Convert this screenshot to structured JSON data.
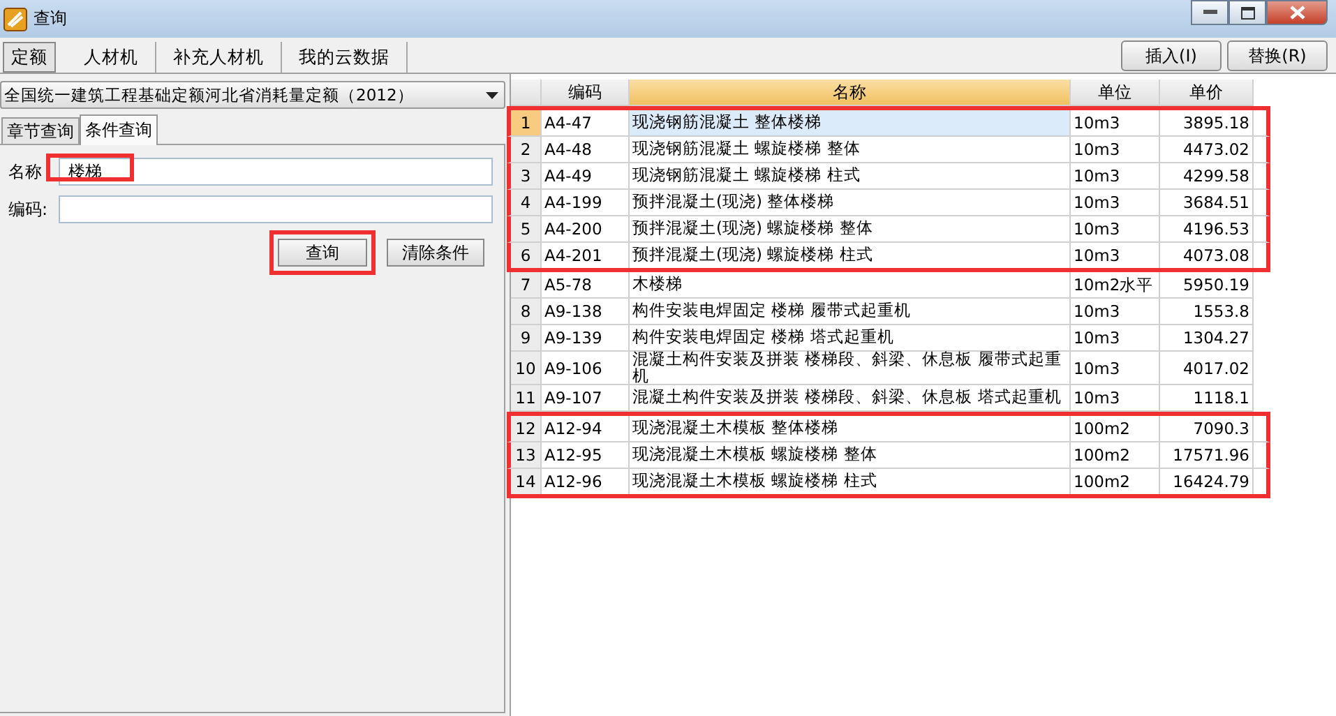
{
  "window": {
    "title": "查询"
  },
  "tabs": [
    {
      "label": "定额",
      "selected": true
    },
    {
      "label": "人材机",
      "selected": false
    },
    {
      "label": "补充人材机",
      "selected": false
    },
    {
      "label": "我的云数据",
      "selected": false
    }
  ],
  "actions": [
    "插入(I)",
    "替换(R)"
  ],
  "library": {
    "value": "全国统一建筑工程基础定额河北省消耗量定额（2012）"
  },
  "query_tabs": [
    {
      "label": "章节查询",
      "selected": false
    },
    {
      "label": "条件查询",
      "selected": true
    }
  ],
  "form": {
    "fields": [
      {
        "label": "名称",
        "value": "楼梯",
        "highlighted": true
      },
      {
        "label": "编码:",
        "highlighted": false
      }
    ],
    "buttons": [
      {
        "label": "查询",
        "highlighted": true
      },
      {
        "label": "清除条件",
        "highlighted": false
      }
    ]
  },
  "table": {
    "columns": [
      {
        "selected": false
      },
      {
        "label": "编码",
        "selected": false
      },
      {
        "label": "名称",
        "selected": true
      },
      {
        "label": "单位",
        "selected": false
      },
      {
        "label": "单价",
        "selected": false
      }
    ],
    "rows": [
      {
        "no": "1",
        "code": "A4-47",
        "name": "现浇钢筋混凝土 整体楼梯",
        "unit": "10m3",
        "price": "3895.18",
        "selected": true,
        "highlighted": true
      },
      {
        "no": "2",
        "code": "A4-48",
        "name": "现浇钢筋混凝土 螺旋楼梯 整体",
        "unit": "10m3",
        "price": "4473.02",
        "selected": false,
        "highlighted": true
      },
      {
        "no": "3",
        "code": "A4-49",
        "name": "现浇钢筋混凝土 螺旋楼梯 柱式",
        "unit": "10m3",
        "price": "4299.58",
        "selected": false,
        "highlighted": true
      },
      {
        "no": "4",
        "code": "A4-199",
        "name": "预拌混凝土(现浇) 整体楼梯",
        "unit": "10m3",
        "price": "3684.51",
        "selected": false,
        "highlighted": true
      },
      {
        "no": "5",
        "code": "A4-200",
        "name": "预拌混凝土(现浇) 螺旋楼梯 整体",
        "unit": "10m3",
        "price": "4196.53",
        "selected": false,
        "highlighted": true
      },
      {
        "no": "6",
        "code": "A4-201",
        "name": "预拌混凝土(现浇) 螺旋楼梯 柱式",
        "unit": "10m3",
        "price": "4073.08",
        "selected": false,
        "highlighted": true
      },
      {
        "no": "7",
        "code": "A5-78",
        "name": "木楼梯",
        "unit": "10m2水平",
        "price": "5950.19",
        "selected": false,
        "highlighted": false
      },
      {
        "no": "8",
        "code": "A9-138",
        "name": "构件安装电焊固定 楼梯 履带式起重机",
        "unit": "10m3",
        "price": "1553.8",
        "selected": false,
        "highlighted": false
      },
      {
        "no": "9",
        "code": "A9-139",
        "name": "构件安装电焊固定 楼梯 塔式起重机",
        "unit": "10m3",
        "price": "1304.27",
        "selected": false,
        "highlighted": false
      },
      {
        "no": "10",
        "code": "A9-106",
        "name": "混凝土构件安装及拼装 楼梯段、斜梁、休息板 履带式起重机",
        "unit": "10m3",
        "price": "4017.02",
        "selected": false,
        "highlighted": false
      },
      {
        "no": "11",
        "code": "A9-107",
        "name": "混凝土构件安装及拼装 楼梯段、斜梁、休息板 塔式起重机",
        "unit": "10m3",
        "price": "1118.1",
        "selected": false,
        "highlighted": false
      },
      {
        "no": "12",
        "code": "A12-94",
        "name": "现浇混凝土木模板 整体楼梯",
        "unit": "100m2",
        "price": "7090.3",
        "selected": false,
        "highlighted": true
      },
      {
        "no": "13",
        "code": "A12-95",
        "name": "现浇混凝土木模板 螺旋楼梯 整体",
        "unit": "100m2",
        "price": "17571.96",
        "selected": false,
        "highlighted": true
      },
      {
        "no": "14",
        "code": "A12-96",
        "name": "现浇混凝土木模板 螺旋楼梯 柱式",
        "unit": "100m2",
        "price": "16424.79",
        "selected": false,
        "highlighted": true
      }
    ]
  }
}
